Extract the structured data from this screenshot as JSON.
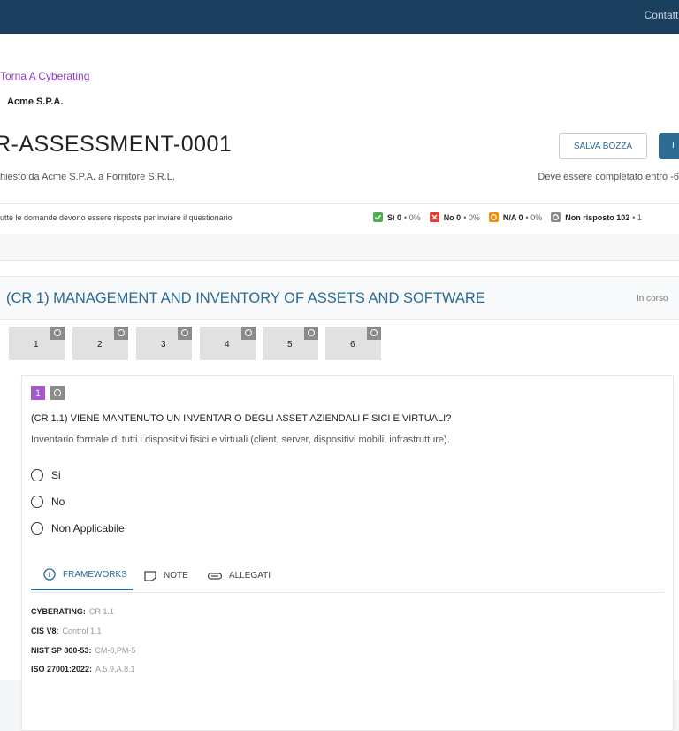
{
  "topbar": {
    "contact": "Contatti"
  },
  "back_link": "Torna A Cyberating",
  "company": "Acme S.P.A.",
  "title": "R-ASSESSMENT-0001",
  "buttons": {
    "save_draft": "SALVA BOZZA",
    "send": "I"
  },
  "requested_text": "hiesto da Acme S.P.A. a Fornitore S.R.L.",
  "deadline_text": "Deve essere completato entro -6",
  "status": {
    "note": "utte le domande devono essere risposte per inviare il questionario",
    "legend": [
      {
        "label": "Sì 0",
        "pct": "0%",
        "color": "#4caf50"
      },
      {
        "label": "No 0",
        "pct": "0%",
        "color": "#e53935"
      },
      {
        "label": "N/A 0",
        "pct": "0%",
        "color": "#fb8c00"
      },
      {
        "label": "Non risposto 102",
        "pct": "1",
        "color": "#8b8b8b"
      }
    ]
  },
  "section": {
    "title": "(CR 1) MANAGEMENT AND INVENTORY OF ASSETS AND SOFTWARE",
    "status": "In corso"
  },
  "question_tabs": [
    "1",
    "2",
    "3",
    "4",
    "5",
    "6"
  ],
  "question": {
    "number": "1",
    "title": "(CR 1.1) VIENE MANTENUTO UN INVENTARIO DEGLI ASSET AZIENDALI FISICI E VIRTUALI?",
    "description": "Inventario formale di tutti i dispositivi fisici e virtuali (client, server, dispositivi mobili, infrastrutture).",
    "options": [
      "Si",
      "No",
      "Non Applicabile"
    ]
  },
  "detail_tabs": {
    "frameworks": "FRAMEWORKS",
    "note": "NOTE",
    "attachments": "ALLEGATI"
  },
  "frameworks": [
    {
      "key": "CYBERATING:",
      "value": "CR 1.1"
    },
    {
      "key": "CIS V8:",
      "value": "Control 1.1"
    },
    {
      "key": "NIST SP 800-53:",
      "value": "CM-8,PM-5"
    },
    {
      "key": "ISO 27001:2022:",
      "value": "A.5.9,A.8.1"
    }
  ],
  "colors": {
    "topbar": "#1b3f5e",
    "accent": "#2a6a94",
    "purple": "#a35bcc"
  }
}
